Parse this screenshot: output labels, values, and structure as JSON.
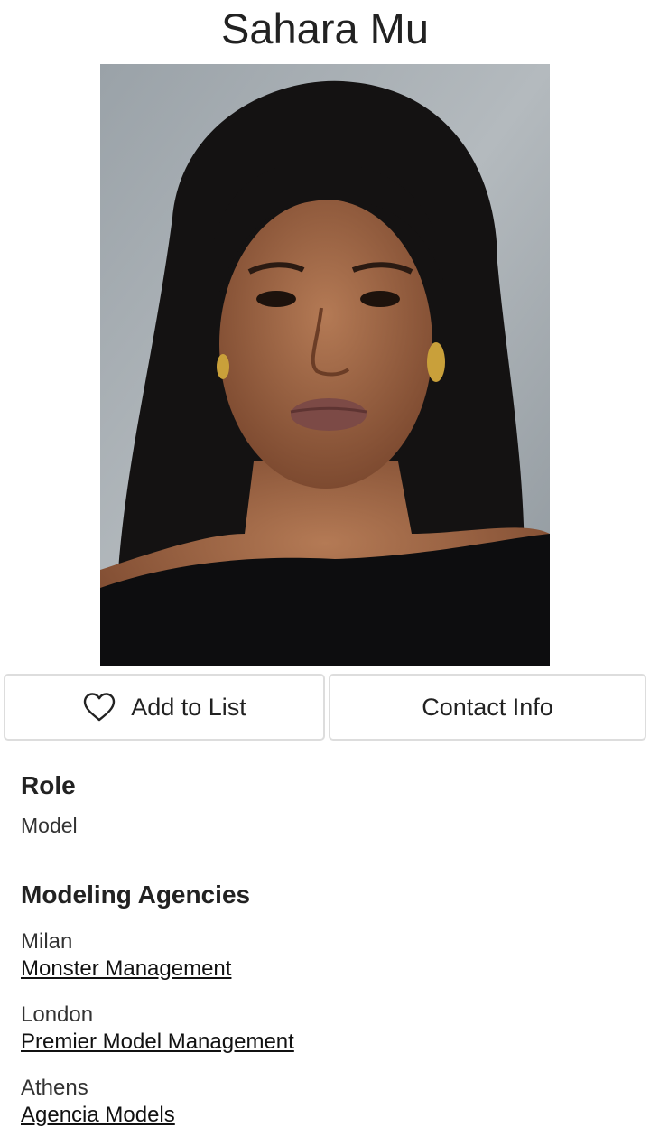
{
  "profile": {
    "name": "Sahara Mu"
  },
  "actions": {
    "add_to_list": "Add to List",
    "contact_info": "Contact Info"
  },
  "role": {
    "heading": "Role",
    "value": "Model"
  },
  "agencies": {
    "heading": "Modeling Agencies",
    "items": [
      {
        "city": "Milan",
        "agency": "Monster Management"
      },
      {
        "city": "London",
        "agency": "Premier Model Management"
      },
      {
        "city": "Athens",
        "agency": "Agencia Models"
      }
    ]
  },
  "icons": {
    "heart": "heart-outline-icon"
  }
}
